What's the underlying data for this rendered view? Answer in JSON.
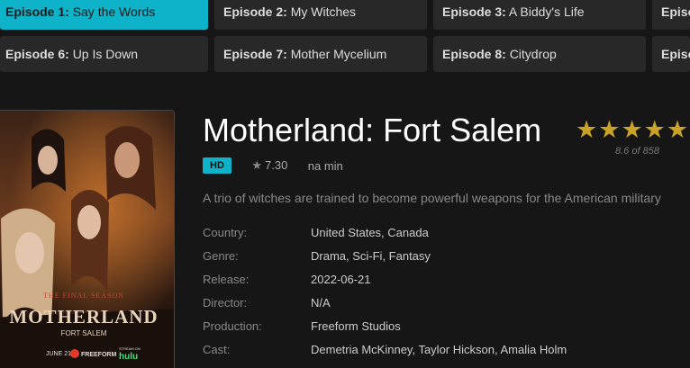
{
  "episodes": [
    {
      "num": "Episode 1:",
      "name": "Say the Words",
      "active": true
    },
    {
      "num": "Episode 2:",
      "name": "My Witches"
    },
    {
      "num": "Episode 3:",
      "name": "A Biddy's Life"
    },
    {
      "num": "Episo",
      "name": ""
    },
    {
      "num": "Episode 6:",
      "name": "Up Is Down"
    },
    {
      "num": "Episode 7:",
      "name": "Mother Mycelium"
    },
    {
      "num": "Episode 8:",
      "name": "Citydrop"
    },
    {
      "num": "Episo",
      "name": ""
    }
  ],
  "poster": {
    "tagline": "THE FINAL SEASON",
    "title": "MOTHERLAND",
    "subtitle": "FORT SALEM",
    "date": "JUNE 21",
    "network": "FREEFORM",
    "stream": "STREAM ON",
    "service": "hulu"
  },
  "show": {
    "title": "Motherland: Fort Salem",
    "rating_sub": "8.6 of 858",
    "stars": 5,
    "quality": "HD",
    "score": "7.30",
    "duration": "na min",
    "description": "A trio of witches are trained to become powerful weapons for the American military"
  },
  "info": [
    {
      "key": "Country:",
      "value": "United States, Canada"
    },
    {
      "key": "Genre:",
      "value": "Drama, Sci-Fi, Fantasy"
    },
    {
      "key": "Release:",
      "value": "2022-06-21"
    },
    {
      "key": "Director:",
      "value": "N/A"
    },
    {
      "key": "Production:",
      "value": "Freeform Studios"
    },
    {
      "key": "Cast:",
      "value": "Demetria McKinney, Taylor Hickson, Amalia Holm"
    }
  ],
  "colors": {
    "accent": "#0fb3c9",
    "star": "#c9a227",
    "background": "#161616"
  }
}
